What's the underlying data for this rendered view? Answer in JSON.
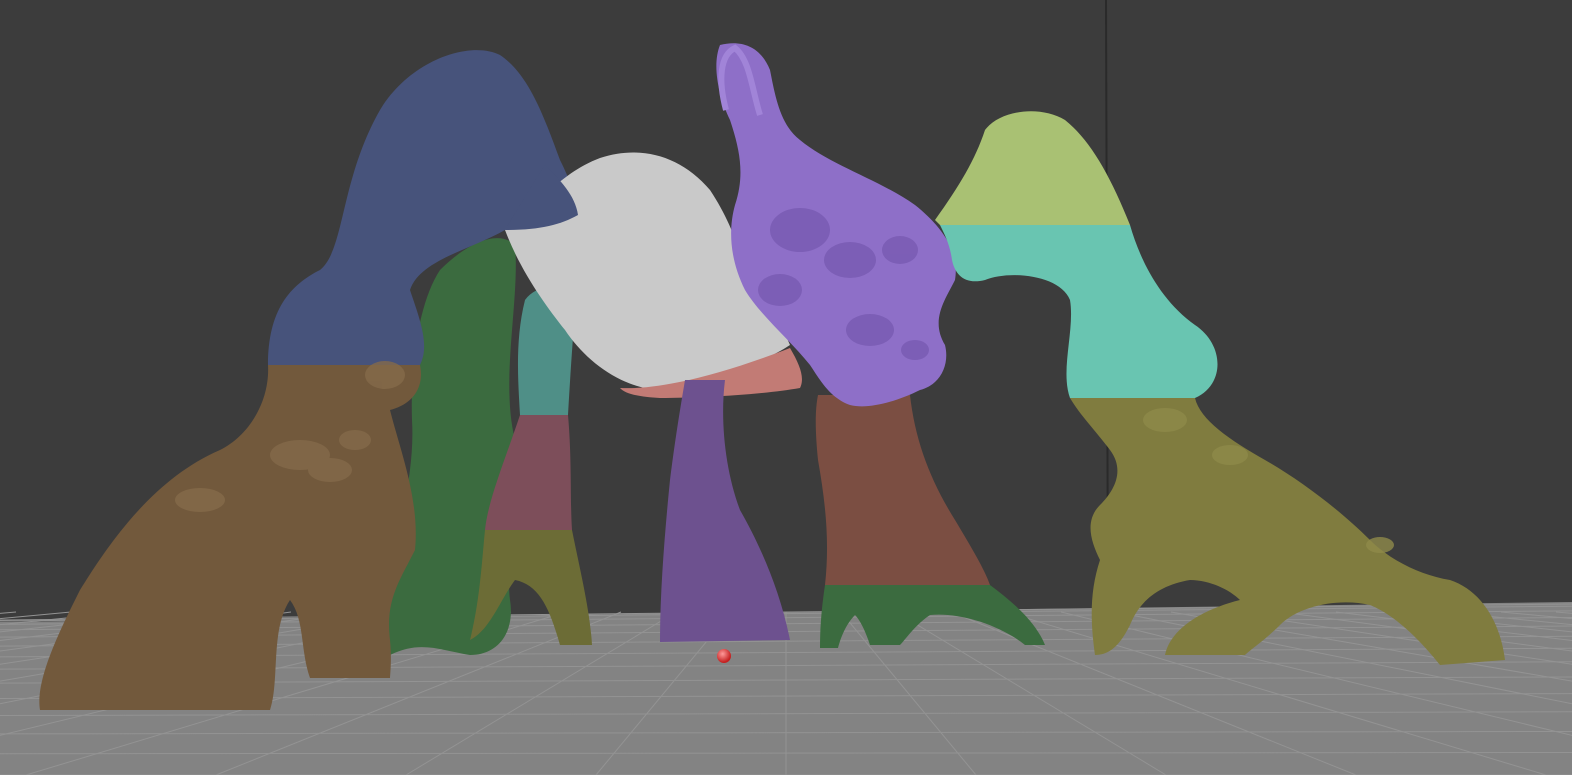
{
  "viewport": {
    "background_color": "#3c3c3c",
    "floor_color": "#838383",
    "grid_line_color": "#939393"
  },
  "model": {
    "polygroup_colors": {
      "blue": "#47537b",
      "brown": "#72593c",
      "dark_green": "#3b6b3f",
      "teal": "#4f8f87",
      "mauve": "#7d4e5a",
      "olive": "#6c6c36",
      "white": "#c9c9c9",
      "violet": "#8e6fc8",
      "purple_leg": "#6d518f",
      "rust": "#7b4e42",
      "lime": "#a9c173",
      "cyan": "#69c5b1",
      "olive_light": "#807c3f",
      "pink": "#c27b75"
    }
  },
  "gizmo": {
    "pivot_color": "#e04040"
  }
}
